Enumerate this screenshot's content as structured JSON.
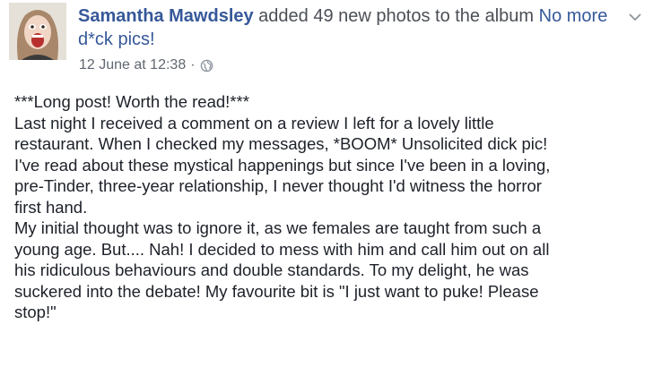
{
  "post": {
    "author_name": "Samantha Mawdsley",
    "action_text": " added 49 new photos to the album ",
    "album_name": "No more d*ck pics!",
    "date": "12 June at 12:38",
    "separator": "·",
    "privacy_icon": "globe-icon",
    "menu_icon": "chevron-down-icon",
    "paragraphs": [
      "***Long post! Worth the read!***",
      "Last night I received a comment on a review I left for a lovely little\nrestaurant. When I checked my messages, *BOOM* Unsolicited dick pic!\nI've read about these mystical happenings but since I've been in a loving,\npre-Tinder, three-year relationship, I never thought I'd witness the horror\nfirst hand.",
      "My initial thought was to ignore it, as we females are taught from such a\nyoung age. But.... Nah! I decided to mess with him and call him out on all\nhis ridiculous behaviours and double standards. To my delight, he was\nsuckered into the debate! My favourite bit is \"I just want to puke! Please\nstop!\""
    ]
  },
  "colors": {
    "link": "#365899",
    "text": "#1d2129",
    "meta": "#616770"
  }
}
